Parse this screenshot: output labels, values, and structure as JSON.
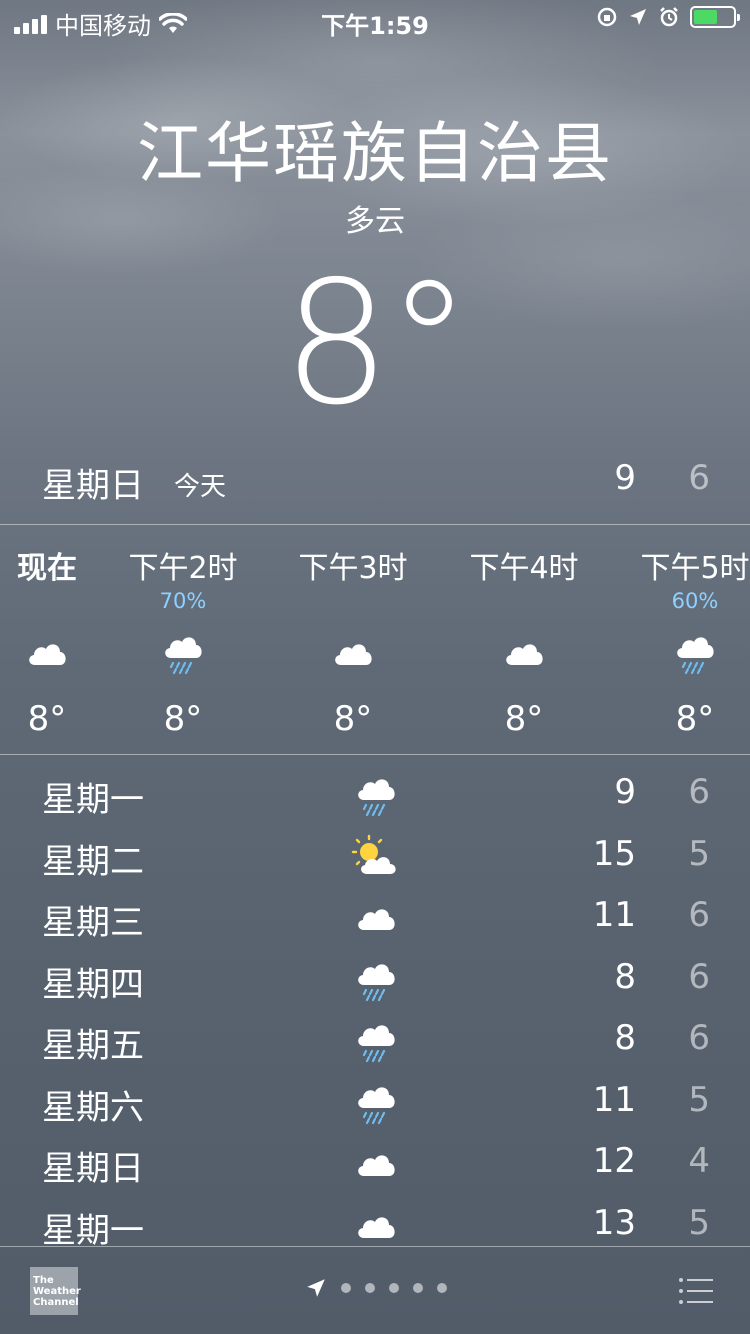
{
  "status_bar": {
    "carrier": "中国移动",
    "time": "下午1:59"
  },
  "location": {
    "city": "江华瑶族自治县",
    "condition": "多云",
    "current_temp": "8°"
  },
  "today": {
    "day": "星期日",
    "label": "今天",
    "high": "9",
    "low": "6"
  },
  "hourly": [
    {
      "label": "现在",
      "pct": "",
      "icon": "cloud-icon",
      "temp": "8°"
    },
    {
      "label": "下午2时",
      "pct": "70%",
      "icon": "rain-icon",
      "temp": "8°"
    },
    {
      "label": "下午3时",
      "pct": "",
      "icon": "cloud-icon",
      "temp": "8°"
    },
    {
      "label": "下午4时",
      "pct": "",
      "icon": "cloud-icon",
      "temp": "8°"
    },
    {
      "label": "下午5时",
      "pct": "60%",
      "icon": "rain-icon",
      "temp": "8°"
    }
  ],
  "daily": [
    {
      "day": "星期一",
      "icon": "rain-icon",
      "high": "9",
      "low": "6"
    },
    {
      "day": "星期二",
      "icon": "partly-sunny-icon",
      "high": "15",
      "low": "5"
    },
    {
      "day": "星期三",
      "icon": "cloud-icon",
      "high": "11",
      "low": "6"
    },
    {
      "day": "星期四",
      "icon": "rain-icon",
      "high": "8",
      "low": "6"
    },
    {
      "day": "星期五",
      "icon": "rain-icon",
      "high": "8",
      "low": "6"
    },
    {
      "day": "星期六",
      "icon": "rain-icon",
      "high": "11",
      "low": "5"
    },
    {
      "day": "星期日",
      "icon": "cloud-icon",
      "high": "12",
      "low": "4"
    },
    {
      "day": "星期一",
      "icon": "cloud-icon",
      "high": "13",
      "low": "5"
    }
  ],
  "footer": {
    "logo_text": "The Weather Channel"
  },
  "colors": {
    "precip_blue": "#8fd0ff",
    "battery_green": "#4cd964"
  }
}
